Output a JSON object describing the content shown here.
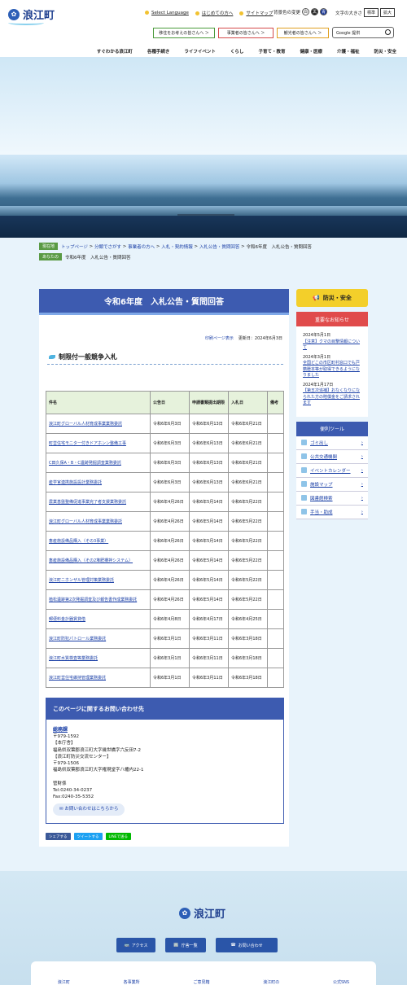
{
  "site": {
    "name": "浪江町",
    "logo_icon": "town-emblem-icon"
  },
  "util": {
    "language": "Select Language",
    "first": "はじめての方へ",
    "sitemap": "サイトマップ",
    "bg_label": "背景色の変更",
    "bg_white": "白",
    "bg_black": "黒",
    "bg_blue": "青",
    "font_label": "文字の大きさ",
    "font_std": "標準",
    "font_big": "拡大"
  },
  "audience": [
    {
      "label": "移住をお考えの皆さんへ ＞",
      "color": "#4a9a3a"
    },
    {
      "label": "事業者の皆さんへ ＞",
      "color": "#d44a4a"
    },
    {
      "label": "観光者の皆さんへ ＞",
      "color": "#e0a020"
    }
  ],
  "search": {
    "placeholder": "Google 提供"
  },
  "gnav": [
    "すぐわかる浪江町",
    "各種手続き",
    "ライフイベント",
    "くらし",
    "子育て・教育",
    "健康・医療",
    "介護・福祉",
    "防災・安全"
  ],
  "breadcrumb": {
    "current_label": "現在地",
    "trail": [
      "トップページ",
      "分類でさがす",
      "事業者の方へ",
      "入札・契約情報",
      "入札公告・質問回答"
    ],
    "current": "令和6年度　入札公告・質問回答",
    "parent_label": "あなたの",
    "parent": "令和6年度　入札公告・質問回答"
  },
  "page": {
    "title": "令和6年度　入札公告・質問回答",
    "print": "印刷ページ表示",
    "updated": "更新日：2024年6月3日",
    "subheading": "制限付一般競争入札"
  },
  "table": {
    "headers": [
      "件名",
      "公告日",
      "申請書類提出期限",
      "入札日",
      "備考"
    ],
    "rows": [
      [
        "浪江町グローバル人材育成事業業務委託",
        "令和6年6月3日",
        "令和6年6月13日",
        "令和6年6月21日",
        ""
      ],
      [
        "町営住宅モニター付きドアホンン整備工事",
        "令和6年6月3日",
        "令和6年6月13日",
        "令和6年6月21日",
        ""
      ],
      [
        "C田久保A・B・C遺跡発掘調査業務委託",
        "令和6年6月3日",
        "令和6年6月13日",
        "令和6年6月21日",
        ""
      ],
      [
        "産学官連携施設設計業務委託",
        "令和6年6月3日",
        "令和6年6月13日",
        "令和6年6月21日",
        ""
      ],
      [
        "農業基盤整備促進事業完了者支援業務委託",
        "令和6年4月26日",
        "令和6年5月14日",
        "令和6年5月22日",
        ""
      ],
      [
        "浪江町グローバル人材育成事業業務委託",
        "令和6年4月26日",
        "令和6年5月14日",
        "令和6年5月22日",
        ""
      ],
      [
        "畜産施設備品購入（その3事業）",
        "令和6年4月26日",
        "令和6年5月14日",
        "令和6年5月22日",
        ""
      ],
      [
        "畜産施設備品購入（その2堆肥攪拌システム）",
        "令和6年4月26日",
        "令和6年5月14日",
        "令和6年5月22日",
        ""
      ],
      [
        "浪江町ニホンザル管理対策業務委託",
        "令和6年4月26日",
        "令和6年5月14日",
        "令和6年5月22日",
        ""
      ],
      [
        "植松遺跡第2次発掘調査及び報告書作成業務委託",
        "令和6年4月26日",
        "令和6年5月14日",
        "令和6年5月22日",
        ""
      ],
      [
        "郵便料金計器賃貸借",
        "令和6年4月8日",
        "令和6年4月17日",
        "令和6年4月25日",
        ""
      ],
      [
        "浪江町防犯パトロール業務委託",
        "令和6年3月1日",
        "令和6年3月11日",
        "令和6年3月18日",
        ""
      ],
      [
        "浪江町水質検査等業務委託",
        "令和6年3月1日",
        "令和6年3月11日",
        "令和6年3月18日",
        ""
      ],
      [
        "浪江町営住宅維持管理業務委託",
        "令和6年3月1日",
        "令和6年3月11日",
        "令和6年3月18日",
        ""
      ]
    ]
  },
  "contact": {
    "heading": "このページに関するお問い合わせ先",
    "dept": "総務課",
    "lines": [
      "〒979-1592",
      "【本庁舎】",
      "福島県双葉郡浪江町大字幾世橋字六反田7-2",
      "【浪江町防災交流センター】",
      "〒979-1506",
      "福島県双葉郡浪江町大字権現堂字八幡内22-1",
      "",
      "管財係",
      "Tel:0240-34-0237",
      "Fax:0240-35-5352"
    ],
    "form": "お問い合わせはこちらから"
  },
  "share": [
    {
      "label": "シェアする",
      "color": "#3b5998"
    },
    {
      "label": "ツイートする",
      "color": "#1da1f2"
    },
    {
      "label": "LINEで送る",
      "color": "#00b900"
    }
  ],
  "sidebar": {
    "bousai": "防災・安全",
    "news_heading": "重要なお知らせ",
    "news": [
      {
        "date": "2024年5月1日",
        "text": "【注意】クマの目撃情報について"
      },
      {
        "date": "2024年3月1日",
        "text": "全国どこの市区町村窓口でも戸籍謄本等が取得できるようになりました"
      },
      {
        "date": "2024年1月17日",
        "text": "【第五次追補】おなくなりになられた方の賠償金をご請求されます"
      }
    ],
    "tools_heading": "便利ツール",
    "tools": [
      "ゴミ出し",
      "公共交通機関",
      "イベントカレンダー",
      "施設マップ",
      "図書館検索",
      "手当・助成"
    ]
  },
  "footer": {
    "logo": "浪江町",
    "buttons": [
      "アクセス",
      "庁舎一覧",
      "お問い合わせ"
    ],
    "links": [
      "浪江町",
      "各事業所",
      "ご意見箱",
      "浪江町の",
      "公式SNS"
    ]
  }
}
